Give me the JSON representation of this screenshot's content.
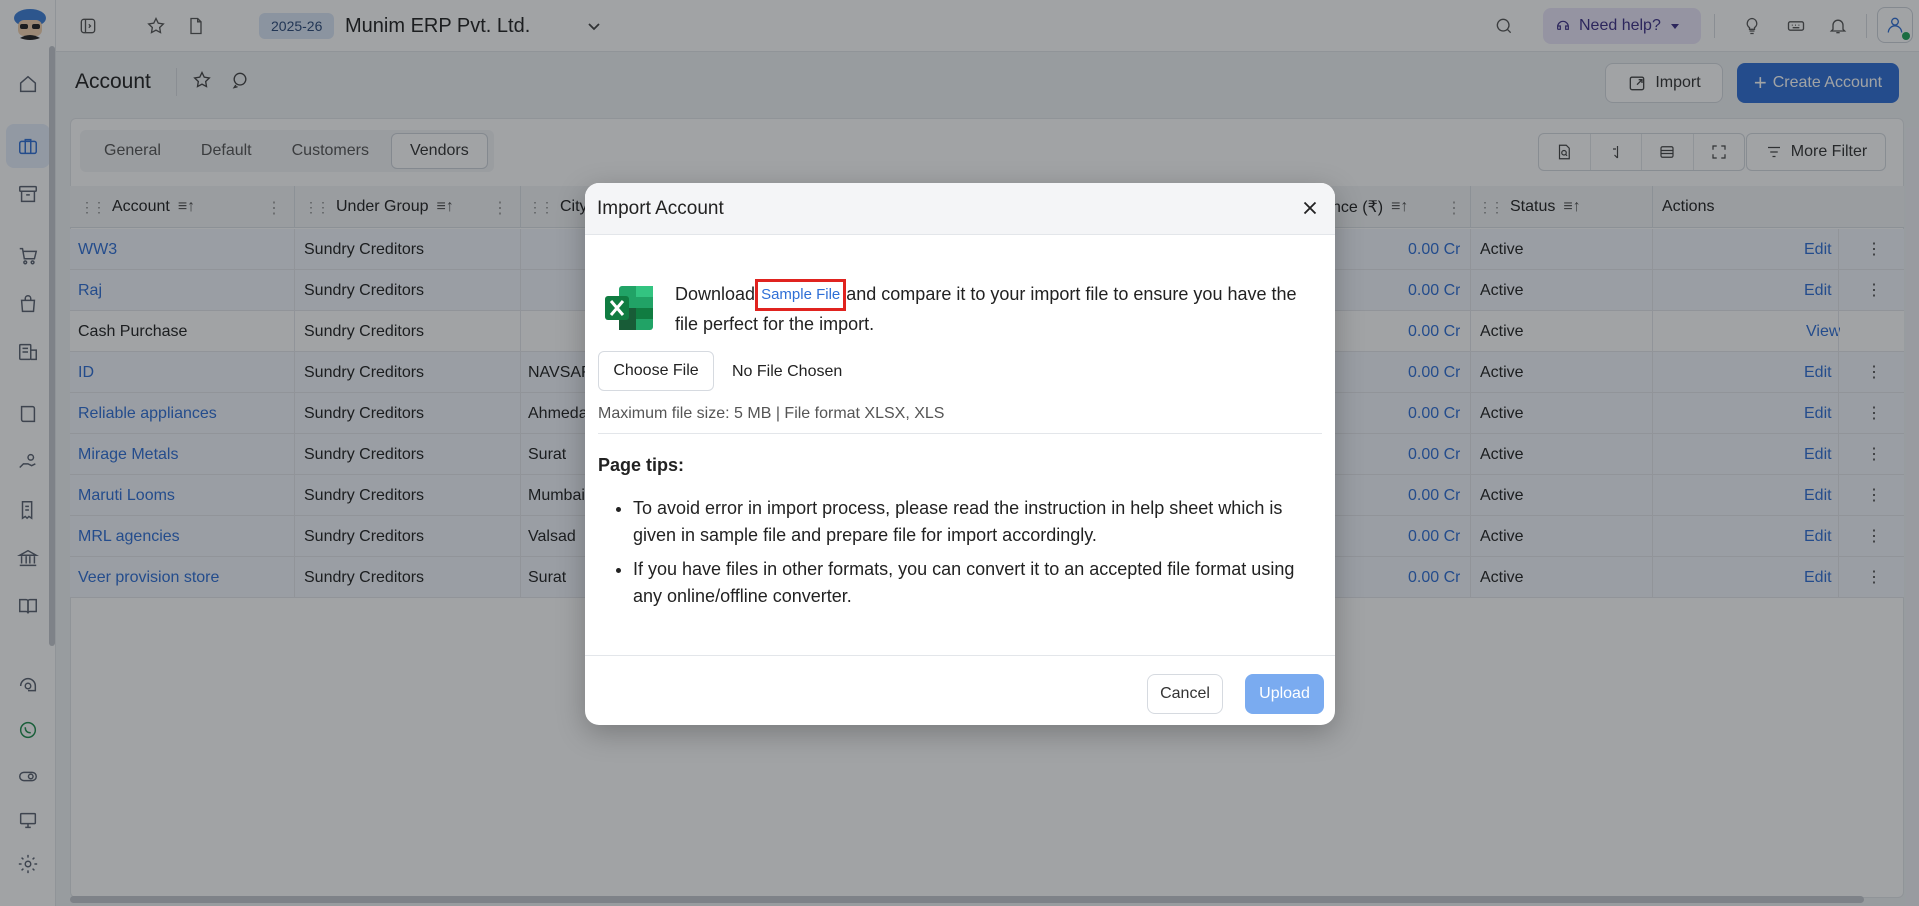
{
  "topbar": {
    "year": "2025-26",
    "company": "Munim ERP Pvt. Ltd.",
    "need_help": "Need help?"
  },
  "header": {
    "title": "Account",
    "import_label": "Import",
    "create_label": "Create Account"
  },
  "tabs": [
    {
      "label": "General"
    },
    {
      "label": "Default"
    },
    {
      "label": "Customers"
    },
    {
      "label": "Vendors"
    }
  ],
  "toolbar": {
    "more_filter": "More Filter"
  },
  "table": {
    "headers": {
      "account": "Account",
      "under_group": "Under Group",
      "city": "City",
      "balance": "nce (₹)",
      "status": "Status",
      "actions": "Actions"
    },
    "rows": [
      {
        "account": "WW3",
        "group": "Sundry Creditors",
        "city": "",
        "balance": "0.00 Cr",
        "status": "Active",
        "action": "Edit",
        "link": true
      },
      {
        "account": "Raj",
        "group": "Sundry Creditors",
        "city": "",
        "balance": "0.00 Cr",
        "status": "Active",
        "action": "Edit",
        "link": true
      },
      {
        "account": "Cash Purchase",
        "group": "Sundry Creditors",
        "city": "",
        "balance": "0.00 Cr",
        "status": "Active",
        "action": "View",
        "link": false
      },
      {
        "account": "ID",
        "group": "Sundry Creditors",
        "city": "NAVSAR",
        "balance": "0.00 Cr",
        "status": "Active",
        "action": "Edit",
        "link": true
      },
      {
        "account": "Reliable appliances",
        "group": "Sundry Creditors",
        "city": "Ahmeda",
        "balance": "0.00 Cr",
        "status": "Active",
        "action": "Edit",
        "link": true
      },
      {
        "account": "Mirage Metals",
        "group": "Sundry Creditors",
        "city": "Surat",
        "balance": "0.00 Cr",
        "status": "Active",
        "action": "Edit",
        "link": true
      },
      {
        "account": "Maruti Looms",
        "group": "Sundry Creditors",
        "city": "Mumbai",
        "balance": "0.00 Cr",
        "status": "Active",
        "action": "Edit",
        "link": true
      },
      {
        "account": "MRL agencies",
        "group": "Sundry Creditors",
        "city": "Valsad",
        "balance": "0.00 Cr",
        "status": "Active",
        "action": "Edit",
        "link": true
      },
      {
        "account": "Veer provision store",
        "group": "Sundry Creditors",
        "city": "Surat",
        "balance": "0.00 Cr",
        "status": "Active",
        "action": "Edit",
        "link": true
      }
    ]
  },
  "modal": {
    "title": "Import Account",
    "download_prefix": "Download",
    "sample_file": "Sample File",
    "download_suffix": "and compare it to your import file to ensure you have the file perfect for the import.",
    "choose_file": "Choose File",
    "no_file": "No File Chosen",
    "max_size": "Maximum file size: 5 MB | File format XLSX, XLS",
    "tips_title": "Page tips:",
    "tips": [
      "To avoid error in import process, please read the instruction in help sheet which is given in sample file and prepare file for import accordingly.",
      "If you have files in other formats, you can convert it to an accepted file format using any online/offline converter."
    ],
    "cancel": "Cancel",
    "upload": "Upload"
  },
  "colors": {
    "accent": "#2f6fd6",
    "highlight_box": "#e0231f",
    "upload_disabled": "#7aabf0"
  }
}
